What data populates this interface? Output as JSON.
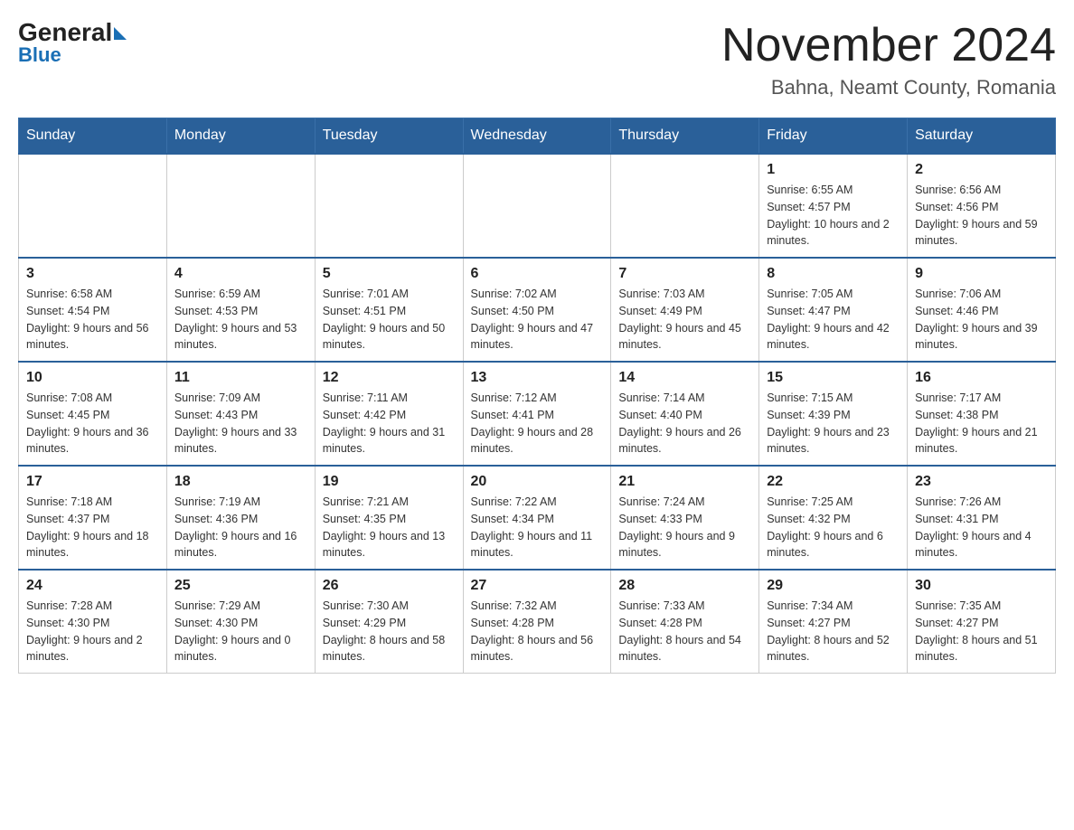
{
  "header": {
    "logo_general": "General",
    "logo_blue": "Blue",
    "month_title": "November 2024",
    "location": "Bahna, Neamt County, Romania"
  },
  "weekdays": [
    "Sunday",
    "Monday",
    "Tuesday",
    "Wednesday",
    "Thursday",
    "Friday",
    "Saturday"
  ],
  "weeks": [
    [
      {
        "day": "",
        "info": ""
      },
      {
        "day": "",
        "info": ""
      },
      {
        "day": "",
        "info": ""
      },
      {
        "day": "",
        "info": ""
      },
      {
        "day": "",
        "info": ""
      },
      {
        "day": "1",
        "info": "Sunrise: 6:55 AM\nSunset: 4:57 PM\nDaylight: 10 hours and 2 minutes."
      },
      {
        "day": "2",
        "info": "Sunrise: 6:56 AM\nSunset: 4:56 PM\nDaylight: 9 hours and 59 minutes."
      }
    ],
    [
      {
        "day": "3",
        "info": "Sunrise: 6:58 AM\nSunset: 4:54 PM\nDaylight: 9 hours and 56 minutes."
      },
      {
        "day": "4",
        "info": "Sunrise: 6:59 AM\nSunset: 4:53 PM\nDaylight: 9 hours and 53 minutes."
      },
      {
        "day": "5",
        "info": "Sunrise: 7:01 AM\nSunset: 4:51 PM\nDaylight: 9 hours and 50 minutes."
      },
      {
        "day": "6",
        "info": "Sunrise: 7:02 AM\nSunset: 4:50 PM\nDaylight: 9 hours and 47 minutes."
      },
      {
        "day": "7",
        "info": "Sunrise: 7:03 AM\nSunset: 4:49 PM\nDaylight: 9 hours and 45 minutes."
      },
      {
        "day": "8",
        "info": "Sunrise: 7:05 AM\nSunset: 4:47 PM\nDaylight: 9 hours and 42 minutes."
      },
      {
        "day": "9",
        "info": "Sunrise: 7:06 AM\nSunset: 4:46 PM\nDaylight: 9 hours and 39 minutes."
      }
    ],
    [
      {
        "day": "10",
        "info": "Sunrise: 7:08 AM\nSunset: 4:45 PM\nDaylight: 9 hours and 36 minutes."
      },
      {
        "day": "11",
        "info": "Sunrise: 7:09 AM\nSunset: 4:43 PM\nDaylight: 9 hours and 33 minutes."
      },
      {
        "day": "12",
        "info": "Sunrise: 7:11 AM\nSunset: 4:42 PM\nDaylight: 9 hours and 31 minutes."
      },
      {
        "day": "13",
        "info": "Sunrise: 7:12 AM\nSunset: 4:41 PM\nDaylight: 9 hours and 28 minutes."
      },
      {
        "day": "14",
        "info": "Sunrise: 7:14 AM\nSunset: 4:40 PM\nDaylight: 9 hours and 26 minutes."
      },
      {
        "day": "15",
        "info": "Sunrise: 7:15 AM\nSunset: 4:39 PM\nDaylight: 9 hours and 23 minutes."
      },
      {
        "day": "16",
        "info": "Sunrise: 7:17 AM\nSunset: 4:38 PM\nDaylight: 9 hours and 21 minutes."
      }
    ],
    [
      {
        "day": "17",
        "info": "Sunrise: 7:18 AM\nSunset: 4:37 PM\nDaylight: 9 hours and 18 minutes."
      },
      {
        "day": "18",
        "info": "Sunrise: 7:19 AM\nSunset: 4:36 PM\nDaylight: 9 hours and 16 minutes."
      },
      {
        "day": "19",
        "info": "Sunrise: 7:21 AM\nSunset: 4:35 PM\nDaylight: 9 hours and 13 minutes."
      },
      {
        "day": "20",
        "info": "Sunrise: 7:22 AM\nSunset: 4:34 PM\nDaylight: 9 hours and 11 minutes."
      },
      {
        "day": "21",
        "info": "Sunrise: 7:24 AM\nSunset: 4:33 PM\nDaylight: 9 hours and 9 minutes."
      },
      {
        "day": "22",
        "info": "Sunrise: 7:25 AM\nSunset: 4:32 PM\nDaylight: 9 hours and 6 minutes."
      },
      {
        "day": "23",
        "info": "Sunrise: 7:26 AM\nSunset: 4:31 PM\nDaylight: 9 hours and 4 minutes."
      }
    ],
    [
      {
        "day": "24",
        "info": "Sunrise: 7:28 AM\nSunset: 4:30 PM\nDaylight: 9 hours and 2 minutes."
      },
      {
        "day": "25",
        "info": "Sunrise: 7:29 AM\nSunset: 4:30 PM\nDaylight: 9 hours and 0 minutes."
      },
      {
        "day": "26",
        "info": "Sunrise: 7:30 AM\nSunset: 4:29 PM\nDaylight: 8 hours and 58 minutes."
      },
      {
        "day": "27",
        "info": "Sunrise: 7:32 AM\nSunset: 4:28 PM\nDaylight: 8 hours and 56 minutes."
      },
      {
        "day": "28",
        "info": "Sunrise: 7:33 AM\nSunset: 4:28 PM\nDaylight: 8 hours and 54 minutes."
      },
      {
        "day": "29",
        "info": "Sunrise: 7:34 AM\nSunset: 4:27 PM\nDaylight: 8 hours and 52 minutes."
      },
      {
        "day": "30",
        "info": "Sunrise: 7:35 AM\nSunset: 4:27 PM\nDaylight: 8 hours and 51 minutes."
      }
    ]
  ]
}
